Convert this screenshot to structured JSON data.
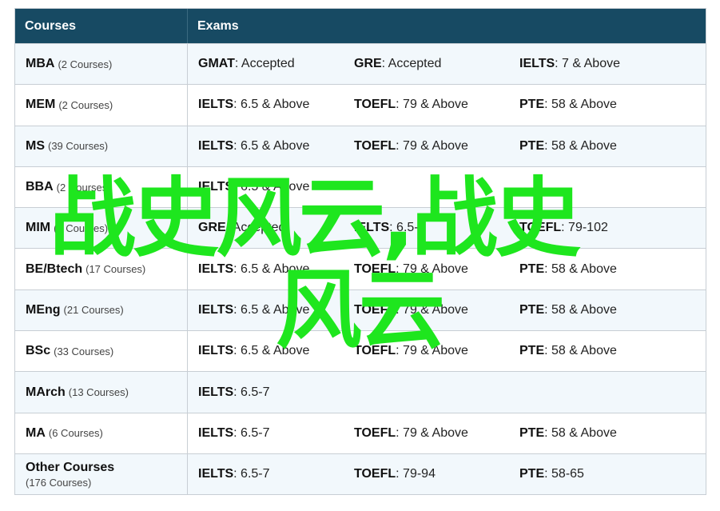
{
  "header": {
    "courses": "Courses",
    "exams": "Exams"
  },
  "rows": [
    {
      "name": "MBA",
      "count": "(2 Courses)",
      "exams": [
        {
          "name": "GMAT",
          "req": ": Accepted"
        },
        {
          "name": "GRE",
          "req": ": Accepted"
        },
        {
          "name": "IELTS",
          "req": ": 7 & Above"
        }
      ]
    },
    {
      "name": "MEM",
      "count": "(2 Courses)",
      "exams": [
        {
          "name": "IELTS",
          "req": ": 6.5 & Above"
        },
        {
          "name": "TOEFL",
          "req": ": 79 & Above"
        },
        {
          "name": "PTE",
          "req": ": 58 & Above"
        }
      ]
    },
    {
      "name": "MS",
      "count": "(39 Courses)",
      "exams": [
        {
          "name": "IELTS",
          "req": ": 6.5 & Above"
        },
        {
          "name": "TOEFL",
          "req": ": 79 & Above"
        },
        {
          "name": "PTE",
          "req": ": 58 & Above"
        }
      ]
    },
    {
      "name": "BBA",
      "count": "(2 Courses)",
      "exams": [
        {
          "name": "IELTS",
          "req": ": 6.5 & Above"
        },
        {
          "name": "",
          "req": ""
        },
        {
          "name": "",
          "req": ""
        }
      ]
    },
    {
      "name": "MIM",
      "count": "(2 Courses)",
      "exams": [
        {
          "name": "GRE",
          "req": ": Accepted"
        },
        {
          "name": "IELTS",
          "req": ": 6.5-7"
        },
        {
          "name": "TOEFL",
          "req": ": 79-102"
        }
      ]
    },
    {
      "name": "BE/Btech",
      "count": "(17 Courses)",
      "exams": [
        {
          "name": "IELTS",
          "req": ": 6.5 & Above"
        },
        {
          "name": "TOEFL",
          "req": ": 79 & Above"
        },
        {
          "name": "PTE",
          "req": ": 58 & Above"
        }
      ]
    },
    {
      "name": "MEng",
      "count": "(21 Courses)",
      "exams": [
        {
          "name": "IELTS",
          "req": ": 6.5 & Above"
        },
        {
          "name": "TOEFL",
          "req": ": 79 & Above"
        },
        {
          "name": "PTE",
          "req": ": 58 & Above"
        }
      ]
    },
    {
      "name": "BSc",
      "count": "(33 Courses)",
      "exams": [
        {
          "name": "IELTS",
          "req": ": 6.5 & Above"
        },
        {
          "name": "TOEFL",
          "req": ": 79 & Above"
        },
        {
          "name": "PTE",
          "req": ": 58 & Above"
        }
      ]
    },
    {
      "name": "MArch",
      "count": "(13 Courses)",
      "exams": [
        {
          "name": "IELTS",
          "req": ": 6.5-7"
        },
        {
          "name": "",
          "req": ""
        },
        {
          "name": "",
          "req": ""
        }
      ]
    },
    {
      "name": "MA",
      "count": "(6 Courses)",
      "exams": [
        {
          "name": "IELTS",
          "req": ": 6.5-7"
        },
        {
          "name": "TOEFL",
          "req": ": 79 & Above"
        },
        {
          "name": "PTE",
          "req": ": 58 & Above"
        }
      ]
    },
    {
      "name": "Other Courses",
      "count": "(176 Courses)",
      "exams": [
        {
          "name": "IELTS",
          "req": ": 6.5-7"
        },
        {
          "name": "TOEFL",
          "req": ": 79-94"
        },
        {
          "name": "PTE",
          "req": ": 58-65"
        }
      ]
    }
  ],
  "watermark": {
    "line1": "战史风云,战史",
    "line2": "风云",
    "color": "#1ee61e"
  }
}
